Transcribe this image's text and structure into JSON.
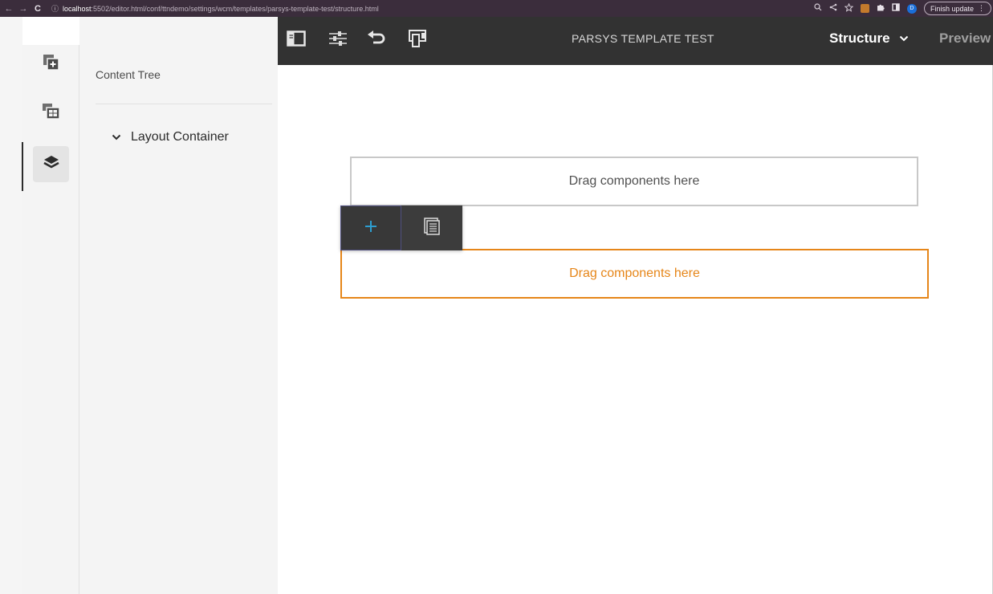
{
  "browser": {
    "back": "←",
    "forward": "→",
    "reload": "C",
    "info": "ⓘ",
    "url_host": "localhost",
    "url_path": ":5502/editor.html/conf/ttndemo/settings/wcm/templates/parsys-template-test/structure.html",
    "finish_update": "Finish update",
    "menu": "⋮",
    "avatar_initial": "D"
  },
  "editor": {
    "page_title": "PARSYS TEMPLATE TEST",
    "mode": "Structure",
    "preview": "Preview"
  },
  "panel": {
    "title": "Content Tree",
    "tree": [
      {
        "label": "Layout Container",
        "expanded": true
      }
    ]
  },
  "canvas": {
    "dropzones": [
      {
        "text": "Drag components here",
        "state": "default"
      },
      {
        "text": "Drag components here",
        "state": "selected"
      }
    ],
    "toolbar": {
      "add_icon": "plus-icon",
      "parent_icon": "parent-icon"
    }
  },
  "colors": {
    "editor_bar": "#323232",
    "selected_outline": "#e68619",
    "add_icon": "#2d9ed1"
  }
}
